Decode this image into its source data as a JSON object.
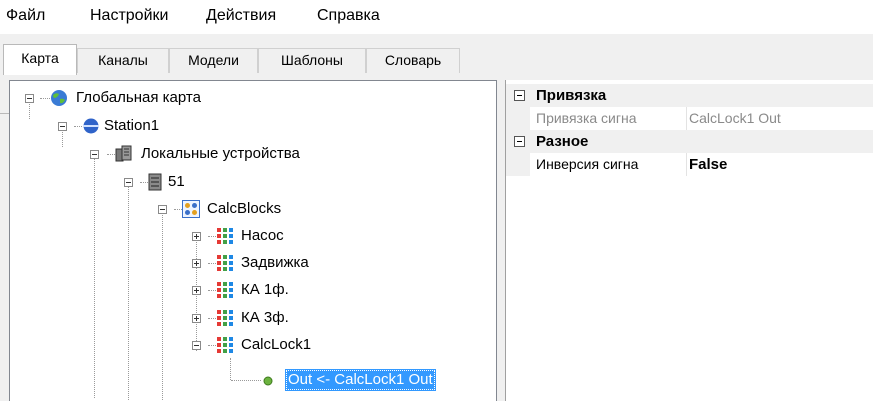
{
  "menu": {
    "file": "Файл",
    "settings": "Настройки",
    "actions": "Действия",
    "help": "Справка"
  },
  "tabs": {
    "map": "Карта",
    "channels": "Каналы",
    "models": "Модели",
    "templates": "Шаблоны",
    "dictionary": "Словарь"
  },
  "tree": {
    "global_map": "Глобальная карта",
    "station": "Station1",
    "local_devices": "Локальные устройства",
    "device": "51",
    "calcblocks": "CalcBlocks",
    "pump": "Насос",
    "valve": "Задвижка",
    "ka1": "КА 1ф.",
    "ka3": "КА 3ф.",
    "calclock": "CalcLock1",
    "out_selected": "Out <- CalcLock1 Out"
  },
  "properties": {
    "category_binding": "Привязка",
    "binding_signal_name": "Привязка сигна",
    "binding_signal_value": "CalcLock1 Out",
    "category_misc": "Разное",
    "inversion_name": "Инверсия сигна",
    "inversion_value": "False"
  },
  "colors": {
    "selection": "#3399ff",
    "accent_station": "#2f63c9",
    "status_green": "#6cb33f"
  }
}
